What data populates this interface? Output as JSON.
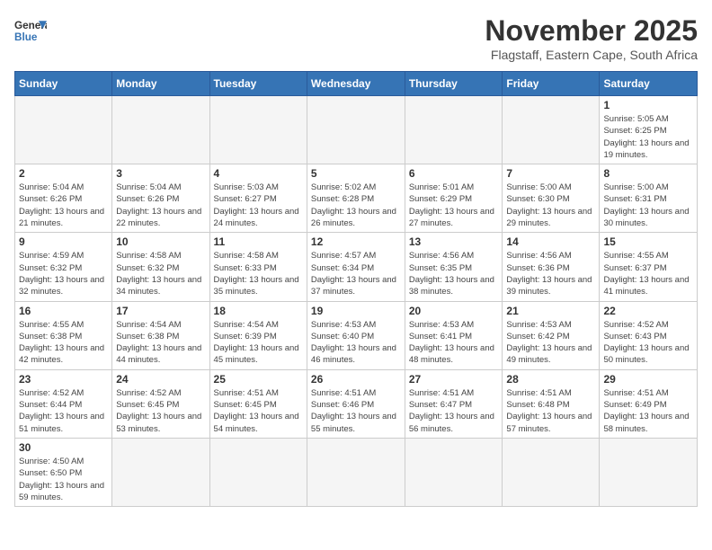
{
  "header": {
    "logo_line1": "General",
    "logo_line2": "Blue",
    "month": "November 2025",
    "location": "Flagstaff, Eastern Cape, South Africa"
  },
  "weekdays": [
    "Sunday",
    "Monday",
    "Tuesday",
    "Wednesday",
    "Thursday",
    "Friday",
    "Saturday"
  ],
  "days": {
    "d1": {
      "n": "1",
      "info": "Sunrise: 5:05 AM\nSunset: 6:25 PM\nDaylight: 13 hours and 19 minutes."
    },
    "d2": {
      "n": "2",
      "info": "Sunrise: 5:04 AM\nSunset: 6:26 PM\nDaylight: 13 hours and 21 minutes."
    },
    "d3": {
      "n": "3",
      "info": "Sunrise: 5:04 AM\nSunset: 6:26 PM\nDaylight: 13 hours and 22 minutes."
    },
    "d4": {
      "n": "4",
      "info": "Sunrise: 5:03 AM\nSunset: 6:27 PM\nDaylight: 13 hours and 24 minutes."
    },
    "d5": {
      "n": "5",
      "info": "Sunrise: 5:02 AM\nSunset: 6:28 PM\nDaylight: 13 hours and 26 minutes."
    },
    "d6": {
      "n": "6",
      "info": "Sunrise: 5:01 AM\nSunset: 6:29 PM\nDaylight: 13 hours and 27 minutes."
    },
    "d7": {
      "n": "7",
      "info": "Sunrise: 5:00 AM\nSunset: 6:30 PM\nDaylight: 13 hours and 29 minutes."
    },
    "d8": {
      "n": "8",
      "info": "Sunrise: 5:00 AM\nSunset: 6:31 PM\nDaylight: 13 hours and 30 minutes."
    },
    "d9": {
      "n": "9",
      "info": "Sunrise: 4:59 AM\nSunset: 6:32 PM\nDaylight: 13 hours and 32 minutes."
    },
    "d10": {
      "n": "10",
      "info": "Sunrise: 4:58 AM\nSunset: 6:32 PM\nDaylight: 13 hours and 34 minutes."
    },
    "d11": {
      "n": "11",
      "info": "Sunrise: 4:58 AM\nSunset: 6:33 PM\nDaylight: 13 hours and 35 minutes."
    },
    "d12": {
      "n": "12",
      "info": "Sunrise: 4:57 AM\nSunset: 6:34 PM\nDaylight: 13 hours and 37 minutes."
    },
    "d13": {
      "n": "13",
      "info": "Sunrise: 4:56 AM\nSunset: 6:35 PM\nDaylight: 13 hours and 38 minutes."
    },
    "d14": {
      "n": "14",
      "info": "Sunrise: 4:56 AM\nSunset: 6:36 PM\nDaylight: 13 hours and 39 minutes."
    },
    "d15": {
      "n": "15",
      "info": "Sunrise: 4:55 AM\nSunset: 6:37 PM\nDaylight: 13 hours and 41 minutes."
    },
    "d16": {
      "n": "16",
      "info": "Sunrise: 4:55 AM\nSunset: 6:38 PM\nDaylight: 13 hours and 42 minutes."
    },
    "d17": {
      "n": "17",
      "info": "Sunrise: 4:54 AM\nSunset: 6:38 PM\nDaylight: 13 hours and 44 minutes."
    },
    "d18": {
      "n": "18",
      "info": "Sunrise: 4:54 AM\nSunset: 6:39 PM\nDaylight: 13 hours and 45 minutes."
    },
    "d19": {
      "n": "19",
      "info": "Sunrise: 4:53 AM\nSunset: 6:40 PM\nDaylight: 13 hours and 46 minutes."
    },
    "d20": {
      "n": "20",
      "info": "Sunrise: 4:53 AM\nSunset: 6:41 PM\nDaylight: 13 hours and 48 minutes."
    },
    "d21": {
      "n": "21",
      "info": "Sunrise: 4:53 AM\nSunset: 6:42 PM\nDaylight: 13 hours and 49 minutes."
    },
    "d22": {
      "n": "22",
      "info": "Sunrise: 4:52 AM\nSunset: 6:43 PM\nDaylight: 13 hours and 50 minutes."
    },
    "d23": {
      "n": "23",
      "info": "Sunrise: 4:52 AM\nSunset: 6:44 PM\nDaylight: 13 hours and 51 minutes."
    },
    "d24": {
      "n": "24",
      "info": "Sunrise: 4:52 AM\nSunset: 6:45 PM\nDaylight: 13 hours and 53 minutes."
    },
    "d25": {
      "n": "25",
      "info": "Sunrise: 4:51 AM\nSunset: 6:45 PM\nDaylight: 13 hours and 54 minutes."
    },
    "d26": {
      "n": "26",
      "info": "Sunrise: 4:51 AM\nSunset: 6:46 PM\nDaylight: 13 hours and 55 minutes."
    },
    "d27": {
      "n": "27",
      "info": "Sunrise: 4:51 AM\nSunset: 6:47 PM\nDaylight: 13 hours and 56 minutes."
    },
    "d28": {
      "n": "28",
      "info": "Sunrise: 4:51 AM\nSunset: 6:48 PM\nDaylight: 13 hours and 57 minutes."
    },
    "d29": {
      "n": "29",
      "info": "Sunrise: 4:51 AM\nSunset: 6:49 PM\nDaylight: 13 hours and 58 minutes."
    },
    "d30": {
      "n": "30",
      "info": "Sunrise: 4:50 AM\nSunset: 6:50 PM\nDaylight: 13 hours and 59 minutes."
    }
  }
}
